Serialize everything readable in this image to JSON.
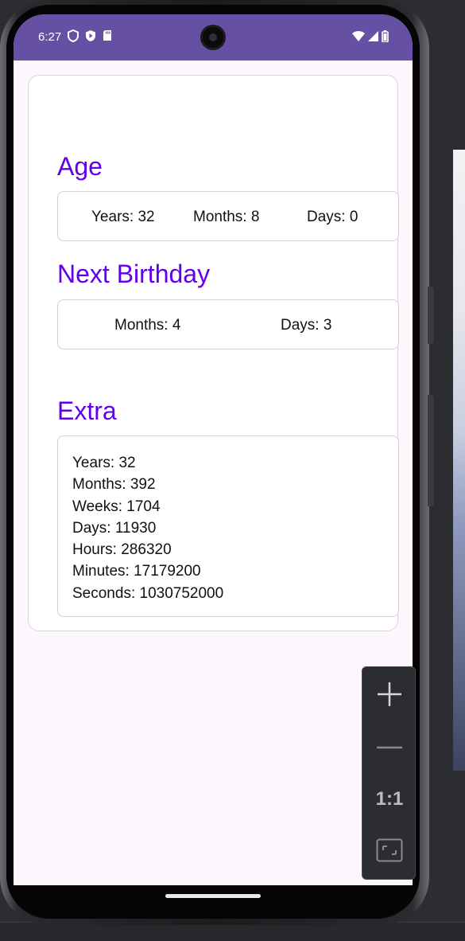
{
  "status_bar": {
    "time": "6:27",
    "left_icons": [
      "vpn-shield-icon",
      "play-protect-icon",
      "sd-card-icon"
    ],
    "right_icons": [
      "wifi-icon",
      "signal-icon",
      "battery-icon"
    ]
  },
  "colors": {
    "status_bar": "#6650a4",
    "section_title": "#6200ee",
    "screen_bg": "#fdf7fd"
  },
  "age": {
    "title": "Age",
    "years": "Years: 32",
    "months": "Months: 8",
    "days": "Days: 0"
  },
  "next_birthday": {
    "title": "Next Birthday",
    "months": "Months: 4",
    "days": "Days: 3"
  },
  "extra": {
    "title": "Extra",
    "lines": [
      "Years: 32",
      "Months: 392",
      "Weeks: 1704",
      "Days: 11930",
      "Hours: 286320",
      "Minutes: 17179200",
      "Seconds: 1030752000"
    ]
  },
  "zoom_panel": {
    "zoom_in_icon": "plus-icon",
    "zoom_out_icon": "minus-icon",
    "actual_size_label": "1:1",
    "fit_icon": "fit-screen-icon"
  }
}
